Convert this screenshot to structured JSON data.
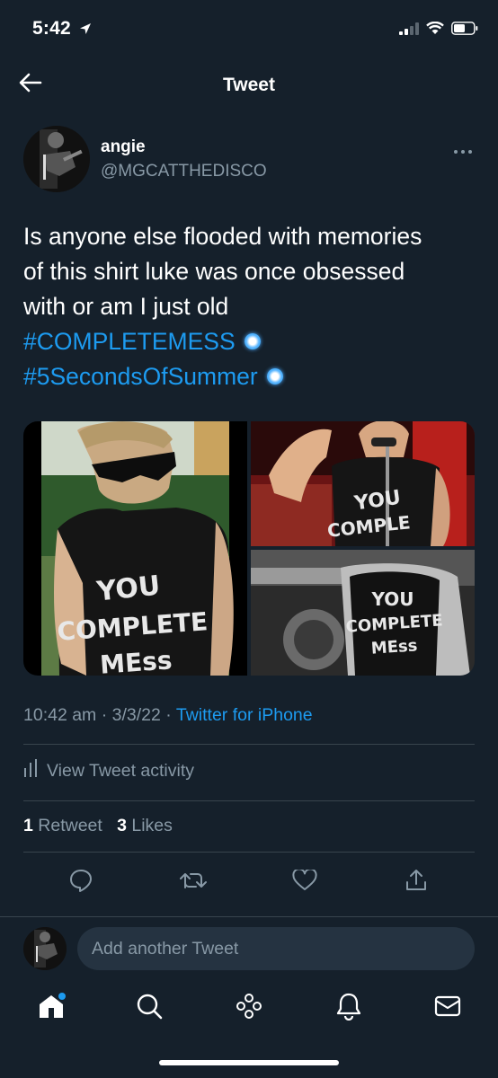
{
  "status_bar": {
    "time": "5:42"
  },
  "nav": {
    "title": "Tweet"
  },
  "author": {
    "name": "angie",
    "handle": "@MGCATTHEDISCO"
  },
  "tweet": {
    "lines": [
      "Is anyone else flooded with memories",
      "of this shirt luke was once obsessed",
      "with or am I just old"
    ],
    "hashtags": [
      "#COMPLETEMESS",
      "#5SecondsOfSummer"
    ]
  },
  "media": {
    "shirt_line1": "YOU",
    "shirt_line2": "COMPLETE",
    "shirt_line3": "MEss",
    "shirt_line2_short": "COMPLE"
  },
  "meta": {
    "time": "10:42 am",
    "date": "3/3/22",
    "separator": "·",
    "source": "Twitter for iPhone"
  },
  "activity": {
    "label": "View Tweet activity"
  },
  "stats": {
    "retweets": "1",
    "retweets_label": "Retweet",
    "likes": "3",
    "likes_label": "Likes"
  },
  "reply": {
    "placeholder": "Add another Tweet"
  },
  "icons": {
    "back": "arrow-left-icon",
    "more": "more-icon",
    "reply": "reply-icon",
    "retweet": "retweet-icon",
    "like": "heart-icon",
    "share": "share-icon",
    "home": "home-icon",
    "search": "search-icon",
    "spaces": "spaces-icon",
    "notifications": "bell-icon",
    "messages": "mail-icon"
  },
  "colors": {
    "background": "#15202b",
    "accent": "#1d9bf0",
    "secondary_text": "#8899a6",
    "divider": "#38444d"
  }
}
